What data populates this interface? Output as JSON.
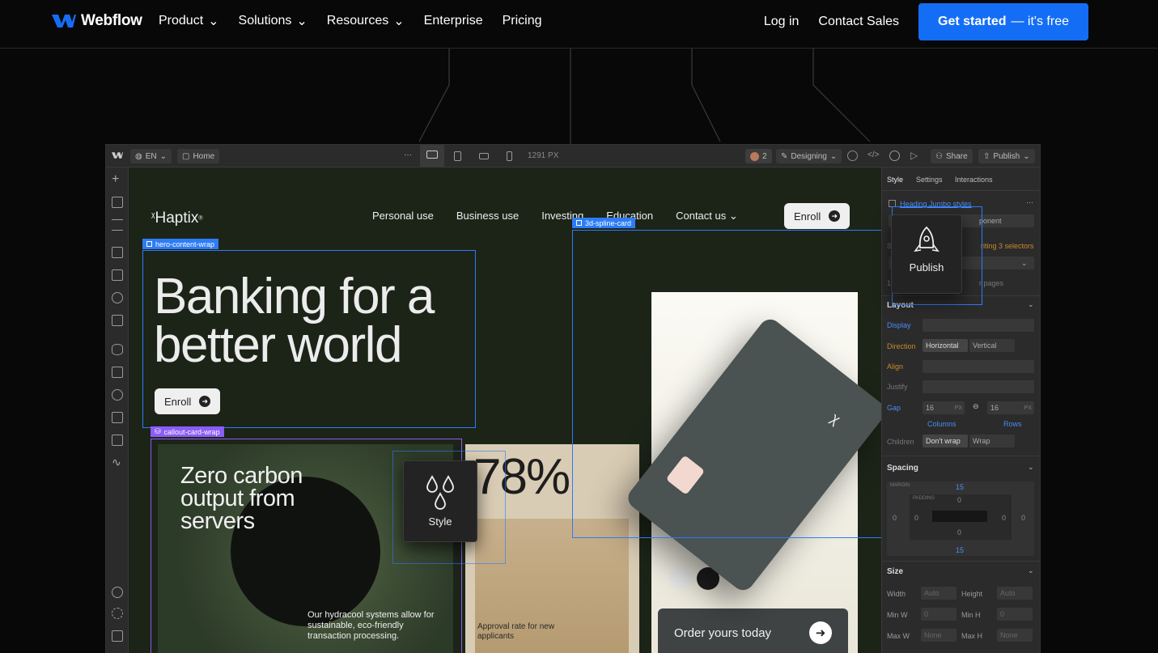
{
  "nav": {
    "logo": "Webflow",
    "items": [
      {
        "label": "Product",
        "dropdown": true
      },
      {
        "label": "Solutions",
        "dropdown": true
      },
      {
        "label": "Resources",
        "dropdown": true
      },
      {
        "label": "Enterprise",
        "dropdown": false
      },
      {
        "label": "Pricing",
        "dropdown": false
      }
    ],
    "login": "Log in",
    "contact": "Contact Sales",
    "cta_main": "Get started",
    "cta_free": "— it's free"
  },
  "designer": {
    "locale": "EN",
    "page": "Home",
    "width_readout": "1291 PX",
    "collab_count": "2",
    "mode": "Designing",
    "share": "Share",
    "publish": "Publish",
    "panel": {
      "tabs": [
        "Style",
        "Settings",
        "Interactions"
      ],
      "selector": "Heading Jumbo styles",
      "component_hint": "ponent",
      "inheriting": "riting 3 selectors",
      "pages_hint": "r pages",
      "sections": {
        "layout": "Layout",
        "spacing": "Spacing",
        "size": "Size"
      },
      "labels": {
        "display": "Display",
        "direction": "Direction",
        "align": "Align",
        "justify": "Justify",
        "gap": "Gap",
        "children": "Children",
        "style_prefix": "Sty",
        "count_prefix": "1 c"
      },
      "direction_options": [
        "Horizontal",
        "Vertical"
      ],
      "gap_values": [
        "16",
        "16"
      ],
      "gap_unit": "PX",
      "gap_labels": [
        "Columns",
        "Rows"
      ],
      "children_options": [
        "Don't wrap",
        "Wrap"
      ],
      "spacing": {
        "margin_label": "MARGIN",
        "padding_label": "PADDING",
        "margin_top": "15",
        "margin_bottom": "15",
        "padding_top": "0",
        "padding_bottom": "0",
        "side_values": [
          "0",
          "0",
          "0",
          "0"
        ]
      },
      "size_fields": [
        {
          "label": "Width",
          "value": "Auto"
        },
        {
          "label": "Height",
          "value": "Auto"
        },
        {
          "label": "Min W",
          "value": "0"
        },
        {
          "label": "Min H",
          "value": "0"
        },
        {
          "label": "Max W",
          "value": "None"
        },
        {
          "label": "Max H",
          "value": "None"
        }
      ]
    }
  },
  "site": {
    "logo": "Haptix",
    "nav": [
      "Personal use",
      "Business use",
      "Investing",
      "Education"
    ],
    "contact": "Contact us",
    "enroll": "Enroll",
    "hero": "Banking for a better world",
    "hero_enroll": "Enroll",
    "zero_carbon": "Zero carbon output from servers",
    "hydracool": "Our hydracool systems allow for sustainable, eco-friendly transaction processing.",
    "stat": "78%",
    "approval": "Approval rate for new applicants",
    "order": "Order yours today"
  },
  "selections": {
    "hero": "hero-content-wrap",
    "callout": "callout-card-wrap",
    "spline": "3d-spline-card"
  },
  "tooltips": {
    "publish": "Publish",
    "style": "Style"
  },
  "colors": {
    "accent": "#146ef5",
    "selection": "#2d7cf6",
    "component": "#8b5cf6"
  }
}
